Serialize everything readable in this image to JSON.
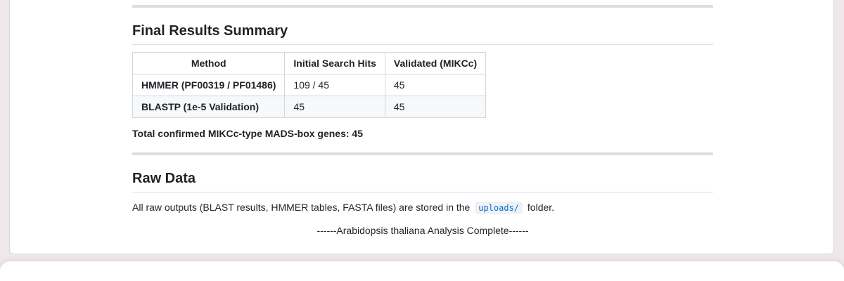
{
  "summary_section": {
    "heading": "Final Results Summary",
    "table": {
      "headers": [
        "Method",
        "Initial Search Hits",
        "Validated (MIKCc)"
      ],
      "rows": [
        [
          "HMMER (PF00319 / PF01486)",
          "109 / 45",
          "45"
        ],
        [
          "BLASTP (1e-5 Validation)",
          "45",
          "45"
        ]
      ]
    },
    "total_text": "Total confirmed MIKCc-type MADS-box genes: 45"
  },
  "raw_data_section": {
    "heading": "Raw Data",
    "text_before": "All raw outputs (BLAST results, HMMER tables, FASTA files) are stored in the",
    "code": "uploads/",
    "text_after": "folder."
  },
  "footer_text": "------Arabidopsis thaliana Analysis Complete------",
  "colors": {
    "page_background": "#f0e8e8",
    "rule": "#d8dee4",
    "link_code": "#0969da",
    "alt_row": "#f6f8fa"
  }
}
